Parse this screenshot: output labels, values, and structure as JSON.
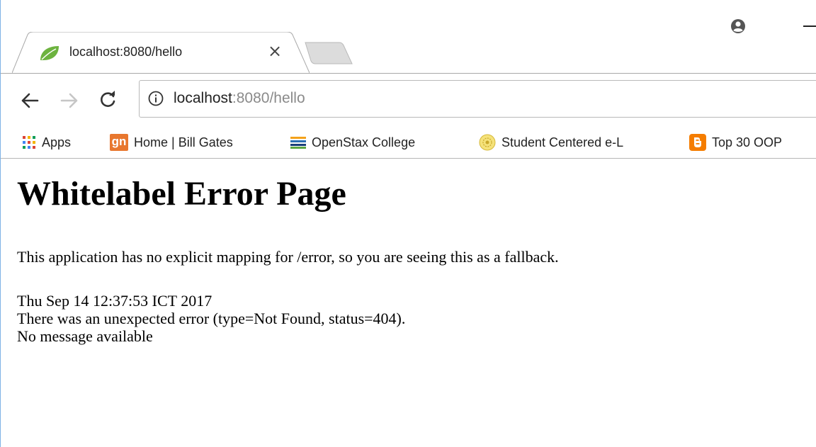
{
  "browser": {
    "tab": {
      "title": "localhost:8080/hello",
      "close": "×"
    },
    "omnibox": {
      "host": "localhost",
      "rest": ":8080/hello"
    },
    "bookmarks": [
      {
        "label": "Apps",
        "icon": "apps-grid-icon"
      },
      {
        "label": "Home | Bill Gates",
        "icon": "gatesnotes-icon",
        "badge": "gn"
      },
      {
        "label": "OpenStax College",
        "icon": "openstax-icon"
      },
      {
        "label": "Student Centered e-L",
        "icon": "university-seal-icon"
      },
      {
        "label": "Top 30 OOP",
        "icon": "blogger-icon"
      }
    ],
    "colors": {
      "accent_orange": "#e8772e",
      "favicon_green": "#6db33f",
      "window_border": "#7fb2e6"
    }
  },
  "page": {
    "heading": "Whitelabel Error Page",
    "description": "This application has no explicit mapping for /error, so you are seeing this as a fallback.",
    "timestamp": "Thu Sep 14 12:37:53 ICT 2017",
    "error_line": "There was an unexpected error (type=Not Found, status=404).",
    "message": "No message available"
  }
}
